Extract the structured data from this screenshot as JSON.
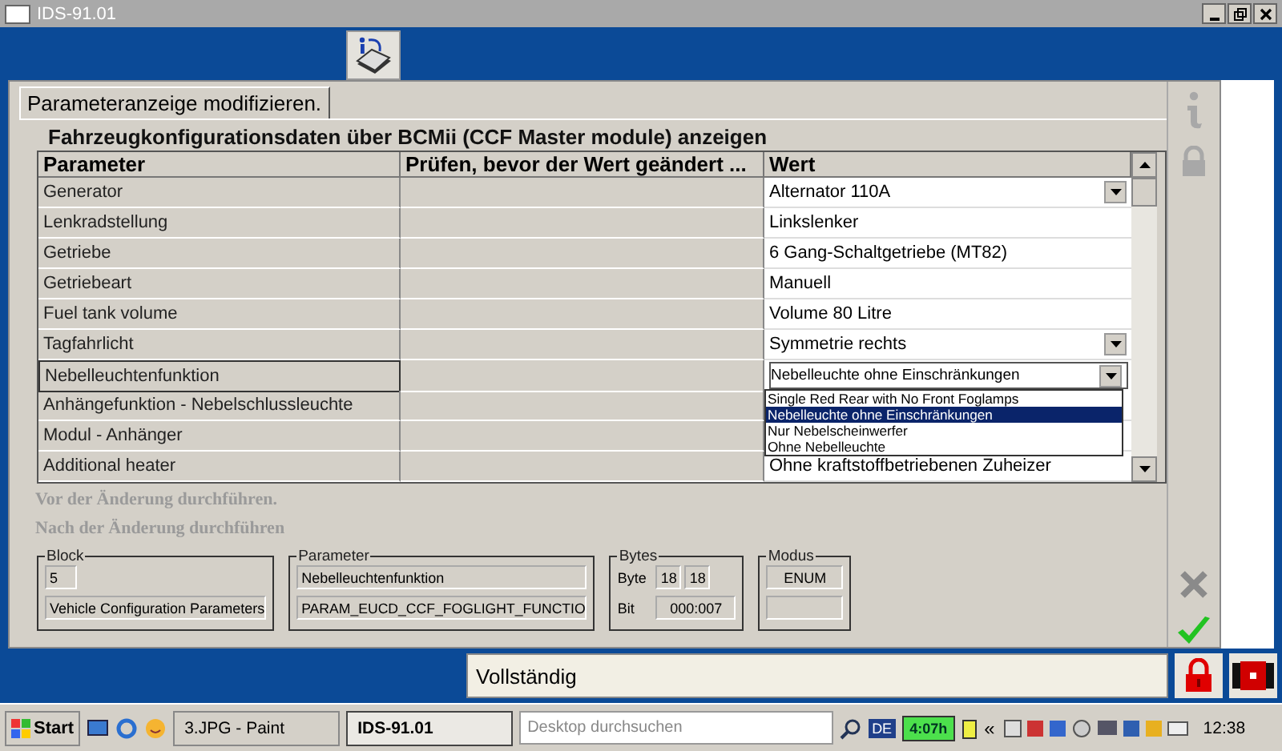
{
  "window": {
    "title": "IDS-91.01"
  },
  "tab": {
    "label": "Parameteranzeige modifizieren.",
    "selected": true
  },
  "heading": "Fahrzeugkonfigurationsdaten über BCMii (CCF Master module) anzeigen",
  "table": {
    "columns": [
      "Parameter",
      "Prüfen, bevor der Wert geändert ...",
      "Wert"
    ],
    "rows": [
      {
        "parameter": "Generator",
        "value": "Alternator 110A",
        "kind": "dropdown",
        "selected": false
      },
      {
        "parameter": "Lenkradstellung",
        "value": "Linkslenker",
        "kind": "text",
        "selected": false
      },
      {
        "parameter": "Getriebe",
        "value": "6 Gang-Schaltgetriebe (MT82)",
        "kind": "text",
        "selected": false
      },
      {
        "parameter": "Getriebeart",
        "value": "Manuell",
        "kind": "text",
        "selected": false
      },
      {
        "parameter": "Fuel tank volume",
        "value": "Volume 80 Litre",
        "kind": "text",
        "selected": false
      },
      {
        "parameter": "Tagfahrlicht",
        "value": "Symmetrie rechts",
        "kind": "dropdown",
        "selected": false
      },
      {
        "parameter": "Nebelleuchtenfunktion",
        "value": "Nebelleuchte ohne Einschränkungen",
        "kind": "combo",
        "selected": true
      },
      {
        "parameter": "Anhängefunktion - Nebelschlussleuchte",
        "value": "",
        "kind": "text",
        "selected": false
      },
      {
        "parameter": "Modul - Anhänger",
        "value": "",
        "kind": "text",
        "selected": false
      },
      {
        "parameter": "Additional heater",
        "value": "Ohne kraftstoffbetriebenen Zuheizer",
        "kind": "text",
        "selected": false
      }
    ],
    "dropdown_options": [
      {
        "label": "Single Red Rear with No Front Foglamps",
        "selected": false
      },
      {
        "label": "Nebelleuchte ohne Einschränkungen",
        "selected": true
      },
      {
        "label": "Nur Nebelscheinwerfer",
        "selected": false
      },
      {
        "label": "Ohne Nebelleuchte",
        "selected": false
      }
    ]
  },
  "steps": [
    {
      "label": "Vor der Änderung durchführen.",
      "disabled": true
    },
    {
      "label": "Nach der Änderung durchführen",
      "disabled": true
    }
  ],
  "details": {
    "block": {
      "title": "Block",
      "number": "5",
      "name": "Vehicle Configuration Parameters"
    },
    "parameter": {
      "title": "Parameter",
      "name": "Nebelleuchtenfunktion",
      "id": "PARAM_EUCD_CCF_FOGLIGHT_FUNCTIO"
    },
    "bytes": {
      "title": "Bytes",
      "byte_label": "Byte",
      "byte_from": "18",
      "byte_to": "18",
      "bit_label": "Bit",
      "bit": "000:007"
    },
    "mode": {
      "title": "Modus",
      "value": "ENUM"
    }
  },
  "status": "Vollständig",
  "taskbar": {
    "start": "Start",
    "tasks": [
      {
        "label": "3.JPG - Paint",
        "selected": false
      },
      {
        "label": "IDS-91.01",
        "selected": true
      }
    ],
    "search_placeholder": "Desktop durchsuchen",
    "language": "DE",
    "battery": "4:07h",
    "expand": "«",
    "time": "12:38"
  }
}
